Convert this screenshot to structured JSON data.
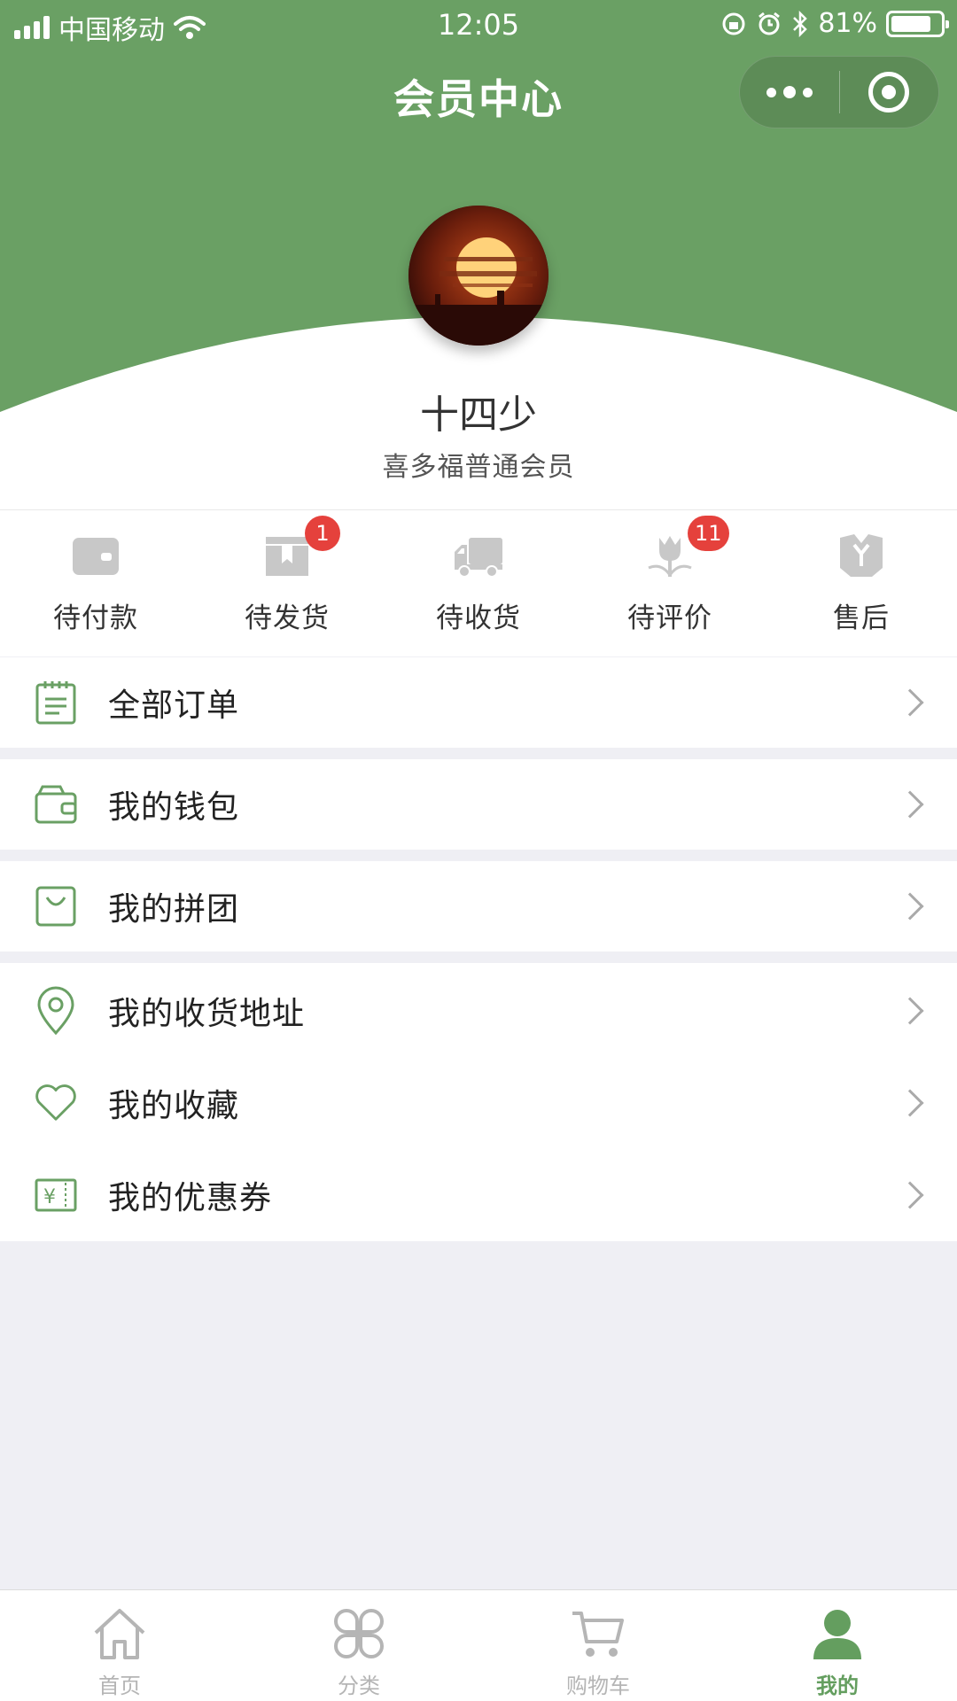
{
  "status_bar": {
    "carrier": "中国移动",
    "time": "12:05",
    "battery": "81%",
    "battery_level": 0.81
  },
  "nav": {
    "title": "会员中心",
    "more_icon": "more-dots-icon",
    "close_icon": "mini-program-close-icon"
  },
  "profile": {
    "username": "十四少",
    "member_level": "喜多福普通会员"
  },
  "orders": [
    {
      "label": "待付款",
      "icon": "wallet-icon",
      "badge": ""
    },
    {
      "label": "待发货",
      "icon": "package-icon",
      "badge": "1"
    },
    {
      "label": "待收货",
      "icon": "truck-icon",
      "badge": ""
    },
    {
      "label": "待评价",
      "icon": "flower-icon",
      "badge": "11"
    },
    {
      "label": "售后",
      "icon": "aftersale-icon",
      "badge": ""
    }
  ],
  "menu": {
    "all_orders": "全部订单",
    "wallet": "我的钱包",
    "group_buy": "我的拼团",
    "address": "我的收货地址",
    "favorites": "我的收藏",
    "coupons": "我的优惠券"
  },
  "tabs": [
    {
      "label": "首页",
      "icon": "home-icon"
    },
    {
      "label": "分类",
      "icon": "category-icon"
    },
    {
      "label": "购物车",
      "icon": "cart-icon"
    },
    {
      "label": "我的",
      "icon": "user-icon",
      "active": true
    }
  ],
  "colors": {
    "brand_green": "#6aa064",
    "badge_red": "#e5413c",
    "icon_gray": "#c8c8c8",
    "background": "#efeff4"
  }
}
